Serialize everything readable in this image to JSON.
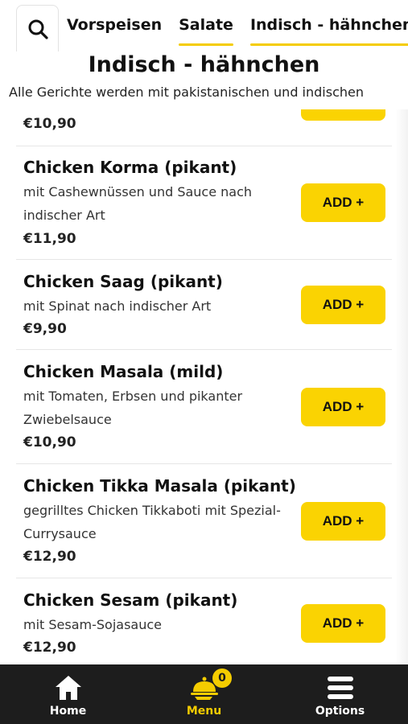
{
  "tabs": [
    {
      "label": "Vorspeisen"
    },
    {
      "label": "Salate"
    },
    {
      "label": "Indisch - hähnchen"
    }
  ],
  "section": {
    "title": "Indisch - hähnchen",
    "description": "Alle Gerichte werden mit pakistanischen und indischen"
  },
  "partial_item": {
    "price": "€10,90"
  },
  "items": [
    {
      "name": "Chicken Korma (pikant)",
      "description": "mit Cashewnüssen und Sauce nach indischer Art",
      "price": "€11,90",
      "add_label": "ADD +"
    },
    {
      "name": "Chicken Saag (pikant)",
      "description": "mit Spinat nach indischer Art",
      "price": "€9,90",
      "add_label": "ADD +"
    },
    {
      "name": "Chicken Masala (mild)",
      "description": "mit Tomaten, Erbsen und pikanter Zwiebelsauce",
      "price": "€10,90",
      "add_label": "ADD +"
    },
    {
      "name": "Chicken Tikka Masala (pikant)",
      "description": "gegrilltes Chicken Tikkaboti mit Spezial-Currysauce",
      "price": "€12,90",
      "add_label": "ADD +"
    },
    {
      "name": "Chicken Sesam (pikant)",
      "description": "mit Sesam-Sojasauce",
      "price": "€12,90",
      "add_label": "ADD +"
    }
  ],
  "bottom_nav": {
    "home": {
      "label": "Home",
      "icon": "home-icon"
    },
    "menu": {
      "label": "Menu",
      "icon": "cloche-icon",
      "badge": "0"
    },
    "options": {
      "label": "Options",
      "icon": "hamburger-icon"
    }
  },
  "colors": {
    "accent": "#fad302",
    "nav_bg": "#1d1d1d",
    "active": "#f4cc00"
  }
}
